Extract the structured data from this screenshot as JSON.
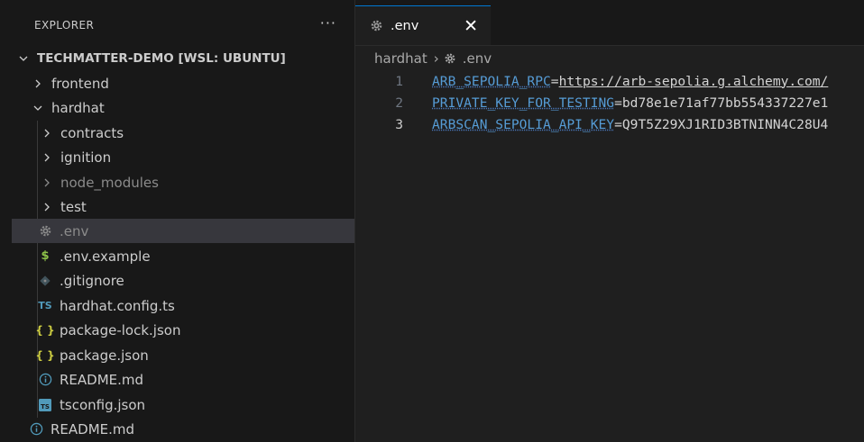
{
  "sidebar": {
    "title": "EXPLORER",
    "more_label": "···",
    "root": "TECHMATTER-DEMO [WSL: UBUNTU]",
    "items": [
      {
        "label": "frontend"
      },
      {
        "label": "hardhat"
      },
      {
        "label": "contracts"
      },
      {
        "label": "ignition"
      },
      {
        "label": "node_modules"
      },
      {
        "label": "test"
      },
      {
        "label": ".env"
      },
      {
        "label": ".env.example",
        "icon": "$"
      },
      {
        "label": ".gitignore"
      },
      {
        "label": "hardhat.config.ts",
        "icon": "TS"
      },
      {
        "label": "package-lock.json",
        "icon": "{ }"
      },
      {
        "label": "package.json",
        "icon": "{ }"
      },
      {
        "label": "README.md"
      },
      {
        "label": "tsconfig.json",
        "icon": "TS"
      },
      {
        "label": "README.md"
      }
    ]
  },
  "editor": {
    "tab": {
      "label": ".env",
      "close_label": "✕"
    },
    "breadcrumb": {
      "folder": "hardhat",
      "sep": "›",
      "file": ".env"
    },
    "lines": [
      {
        "no": "1",
        "key": "ARB_SEPOLIA_RPC",
        "eq": "=",
        "value": "https://arb-sepolia.g.alchemy.com/"
      },
      {
        "no": "2",
        "key": "PRIVATE_KEY_FOR_TESTING",
        "eq": "=",
        "value": "bd78e1e71af77bb554337227e1"
      },
      {
        "no": "3",
        "key": "ARBSCAN_SEPOLIA_API_KEY",
        "eq": "=",
        "value": "Q9T5Z29XJ1RID3BTNINN4C28U4"
      }
    ]
  },
  "colors": {
    "accent": "#0078d4",
    "selected_row": "#37373d",
    "env_key": "#569cd6",
    "json_icon": "#cbcb41",
    "ts_icon": "#519aba",
    "dollar_icon": "#8dc149",
    "info_icon": "#519aba"
  },
  "icons": {
    "more": "ellipsis-icon",
    "chevron_right": "chevron-right-icon",
    "chevron_down": "chevron-down-icon",
    "env": "gear-icon",
    "env_example": "dollar-icon",
    "gitignore": "git-icon",
    "ts": "typescript-icon",
    "json": "json-braces-icon",
    "readme": "info-icon",
    "tsconfig": "tsconfig-icon",
    "close": "close-icon"
  }
}
